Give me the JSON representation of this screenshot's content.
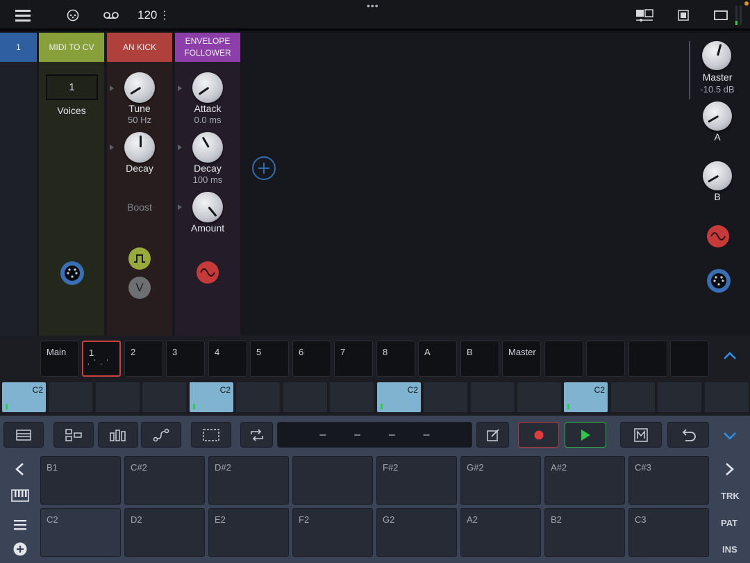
{
  "topbar": {
    "tempo": "120",
    "tempo_menu": "⋮",
    "more": "•••"
  },
  "rack": {
    "track_number": "1",
    "midi_to_cv": {
      "title": "MIDI TO CV",
      "voices_value": "1",
      "voices_label": "Voices"
    },
    "an_kick": {
      "title": "AN KICK",
      "tune_label": "Tune",
      "tune_value": "50 Hz",
      "decay_label": "Decay",
      "boost_label": "Boost",
      "v_label": "V"
    },
    "envelope": {
      "title": "ENVELOPE FOLLOWER",
      "attack_label": "Attack",
      "attack_value": "0.0 ms",
      "decay_label": "Decay",
      "decay_value": "100 ms",
      "amount_label": "Amount"
    },
    "master": {
      "label": "Master",
      "value": "-10.5 dB",
      "a_label": "A",
      "b_label": "B"
    }
  },
  "tracks": [
    "Main",
    "1",
    "2",
    "3",
    "4",
    "5",
    "6",
    "7",
    "8",
    "A",
    "B",
    "Master",
    "",
    "",
    "",
    ""
  ],
  "clips": [
    "C2",
    "",
    "",
    "",
    "C2",
    "",
    "",
    "",
    "C2",
    "",
    "",
    "",
    "C2",
    "",
    "",
    ""
  ],
  "transport": {
    "pattern_dashes": [
      "–",
      "–",
      "–",
      "–"
    ]
  },
  "pads": {
    "top": [
      "B1",
      "C#2",
      "D#2",
      "",
      "F#2",
      "G#2",
      "A#2",
      "C#3"
    ],
    "bottom": [
      "C2",
      "D2",
      "E2",
      "F2",
      "G2",
      "A2",
      "B2",
      "C3"
    ]
  },
  "side_labels": {
    "trk": "TRK",
    "pat": "PAT",
    "ins": "INS"
  },
  "colors": {
    "midi_header": "#87a03a",
    "kick_header": "#b0403c",
    "env_header": "#8c3fa8",
    "track_header": "#2f5fa0",
    "clip_on": "#7fb3d0",
    "record": "#e03a3a",
    "play": "#33c24a",
    "accent": "#2f8fe8"
  }
}
